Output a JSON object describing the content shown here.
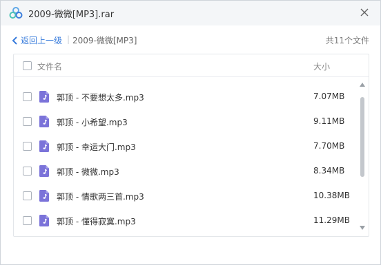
{
  "window": {
    "title": "2009-微微[MP3].rar",
    "app_icon": "cloud-logo-icon",
    "close_icon": "close-icon"
  },
  "nav": {
    "back_label": "返回上一级",
    "separator": "|",
    "current_folder": "2009-微微[MP3]",
    "file_count": "共11个文件"
  },
  "table": {
    "headers": {
      "name": "文件名",
      "size": "大小"
    },
    "rows": [
      {
        "name": "郭顶 - 不要想太多.mp3",
        "size": "7.07MB"
      },
      {
        "name": "郭顶 - 小希望.mp3",
        "size": "9.11MB"
      },
      {
        "name": "郭顶 - 幸运大门.mp3",
        "size": "7.70MB"
      },
      {
        "name": "郭顶 - 微微.mp3",
        "size": "8.34MB"
      },
      {
        "name": "郭顶 - 情歌两三首.mp3",
        "size": "10.38MB"
      },
      {
        "name": "郭顶 - 懂得寂寞.mp3",
        "size": "11.29MB"
      }
    ],
    "file_icon": "music-file-icon"
  },
  "colors": {
    "accent": "#3a7ddc",
    "file_icon": "#7b73d9",
    "titlebar": "#f4f6f8"
  }
}
